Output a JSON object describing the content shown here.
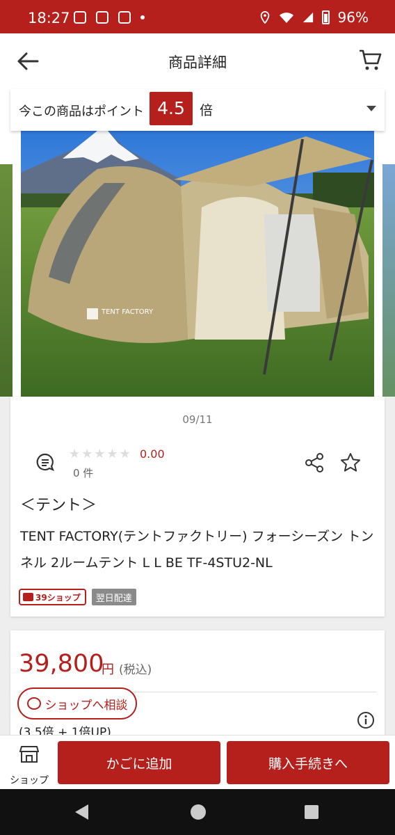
{
  "status_bar": {
    "time": "18:27",
    "battery": "96%",
    "icons": [
      "mail-icon",
      "instagram-icon",
      "app-icon",
      "location-icon",
      "wifi-icon",
      "signal-icon",
      "battery-icon"
    ]
  },
  "app_bar": {
    "title": "商品詳細",
    "back_icon": "back-arrow-icon",
    "cart_icon": "cart-icon"
  },
  "points": {
    "label": "今この商品はポイント",
    "multiplier": "4.5",
    "unit": "倍"
  },
  "gallery": {
    "counter": "09/11",
    "image_brand_text": "TENT FACTORY"
  },
  "product": {
    "rating_value": "0.00",
    "stars_filled": 0,
    "stars_total": 5,
    "review_count": "0 件",
    "category": "＜テント＞",
    "name": "TENT FACTORY(テントファクトリー) フォーシーズン トンネル 2ルームテント L L BE TF-4STU2-NL",
    "badge_shop": "39ショップ",
    "badge_delivery": "翌日配達"
  },
  "price": {
    "amount": "39,800",
    "currency": "円",
    "tax": "(税込)",
    "consult_label": "ショップへ相談",
    "points_note": "(3.5倍 + 1倍UP)"
  },
  "actions": {
    "shop_label": "ショップ",
    "add_to_cart": "かごに追加",
    "checkout": "購入手続きへ"
  },
  "colors": {
    "brand_red": "#b5201c",
    "background": "#eeeeee"
  }
}
